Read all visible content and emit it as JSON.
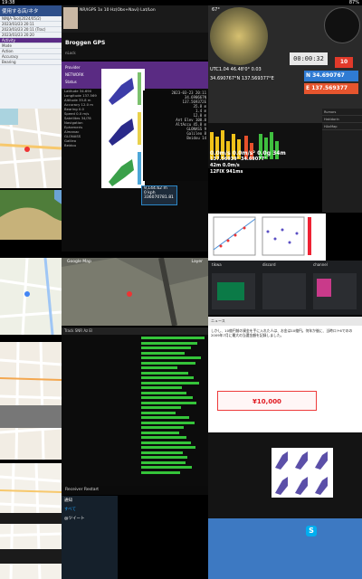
{
  "statusbar": {
    "clock": "19:38",
    "battery": "87%"
  },
  "left_panel": {
    "title": "使用する店/ネタ",
    "rows": [
      "NINJA-Tool(2024/05/2)",
      "2023/03/23 20:11",
      "2023/03/23 20:11 (Trac)",
      "2023/03/23 20:20",
      "Activity",
      "Mode",
      "Action",
      "Accuracy",
      "Bearing"
    ]
  },
  "tabs": {
    "tab1": "NR/IGPS 1x 10 Hz(Obs+Navi) Lat/Lon"
  },
  "gps": {
    "title": "Broggen GPS",
    "rows": [
      "nLock",
      "Lat",
      "Lon"
    ]
  },
  "status": {
    "lbl1": "Provider",
    "lbl2": "Status",
    "val1": "NETWORK",
    "val2": "ACTIVE"
  },
  "info_lines": [
    "Latitude 34.690",
    "Longitude 137.569",
    "Altitude 35.8 m",
    "Accuracy 12.0 m",
    "Bearing 0.0",
    "Speed 0.0 m/s",
    "Satellites 34/78",
    "Navigation",
    "Ephemeris",
    "Almanac",
    "GLONASS",
    "Galileo",
    "Beidou"
  ],
  "numbers": [
    "2023-03-23 20:11",
    "34.690667N",
    "137.569372E",
    "35.8 m",
    "1.4 m",
    "12.0 m",
    "Ant Elev 100.0",
    "AltAccu 45.8 m",
    "GLONASS 9",
    "Galileo 8",
    "Beidou 14"
  ],
  "bigbox": {
    "v1": "9,144.62 m",
    "v2": "0 kph",
    "v3": "336070781.81"
  },
  "sat": {
    "caption": "Google Map",
    "layer": "Layer"
  },
  "table": {
    "header": "Track  SNR  Az  El"
  },
  "reboot": {
    "label": "Receiver Restart"
  },
  "twitter": {
    "title": "通知",
    "tab1": "すべて",
    "tab2": "@ツイート"
  },
  "gpsui": {
    "heading": "67°",
    "time": "00:00:32",
    "lat": "N 34.690767",
    "lon": "E 137.569377",
    "speed": "10",
    "odo": "UTC1.04 46.48'0°  0.03",
    "coords": "34.690767°N  137.569377°E"
  },
  "speedtxt": {
    "l1": "0.0m/s 0.0m/s² 0.0g 34m",
    "l2": "137.56939° 34.69077°",
    "l3": "42m 0.0m/s",
    "l4": "12FIX 941ms"
  },
  "tablist": [
    "Rumors",
    "Hakidorin",
    "HAxMap"
  ],
  "discord": {
    "c1": "tikwa",
    "c2": "discord",
    "c3": "channel"
  },
  "web": {
    "header": "ニュース",
    "para": "しかし、10億円前の資金を手に入れた人は、お金は10億円。何年か後に、当時ロト6でのの2009年7月に最大の当選金額を記録しました。",
    "banner": "¥10,000"
  },
  "bottom": {
    "skype": "S"
  }
}
